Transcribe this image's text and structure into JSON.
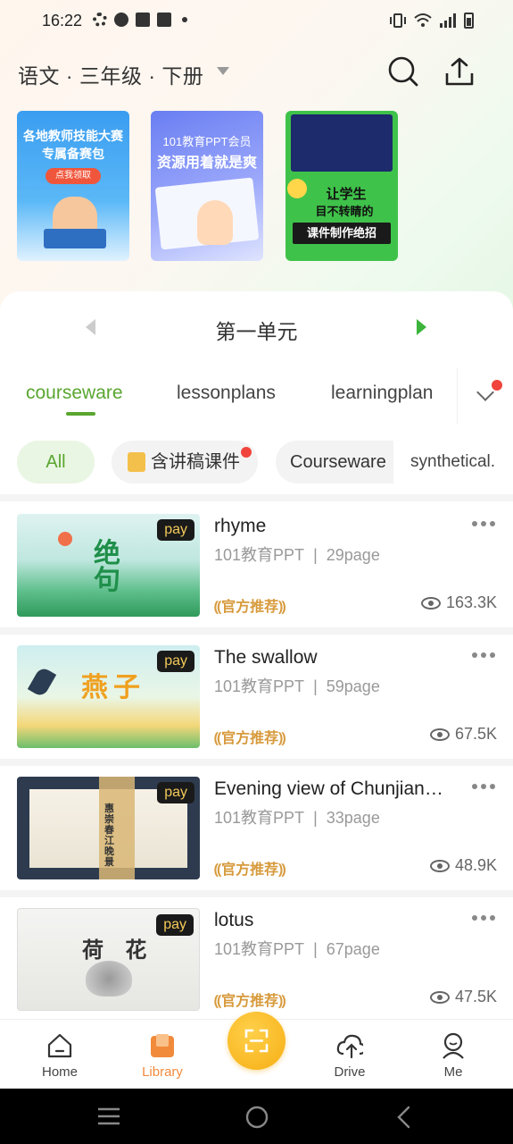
{
  "status": {
    "time": "16:22"
  },
  "header": {
    "subject": "语文 · 三年级 · 下册",
    "search_icon": "search-icon",
    "share_icon": "share-icon"
  },
  "banners": [
    {
      "line1": "各地教师技能大赛",
      "line2": "专属备赛包",
      "button": "点我领取"
    },
    {
      "line1": "101教育PPT会员",
      "line2": "资源用着就是爽"
    },
    {
      "line1": "让学生",
      "line2": "目不转睛的",
      "line3": "课件制作绝招"
    }
  ],
  "unit": {
    "title": "第一单元"
  },
  "tabs": [
    {
      "label": "courseware",
      "active": true
    },
    {
      "label": "lessonplans",
      "active": false
    },
    {
      "label": "learningplan",
      "active": false
    }
  ],
  "filters": [
    {
      "label": "All"
    },
    {
      "label": "含讲稿课件"
    },
    {
      "label": "Courseware"
    },
    {
      "label": "synthetical."
    }
  ],
  "items": [
    {
      "title": "rhyme",
      "publisher": "101教育PPT",
      "pages": "29page",
      "badge": "官方推荐",
      "views": "163.3K",
      "pay": "pay",
      "thumb_text": "绝句"
    },
    {
      "title": "The swallow",
      "publisher": "101教育PPT",
      "pages": "59page",
      "badge": "官方推荐",
      "views": "67.5K",
      "pay": "pay",
      "thumb_text": "燕子"
    },
    {
      "title": "Evening view of Chunjiang...",
      "publisher": "101教育PPT",
      "pages": "33page",
      "badge": "官方推荐",
      "views": "48.9K",
      "pay": "pay",
      "thumb_text": "惠崇春江晚景"
    },
    {
      "title": "lotus",
      "publisher": "101教育PPT",
      "pages": "67page",
      "badge": "官方推荐",
      "views": "47.5K",
      "pay": "pay",
      "thumb_text": "荷 花"
    }
  ],
  "meta_separator": "|",
  "nav": {
    "home": "Home",
    "library": "Library",
    "drive": "Drive",
    "me": "Me"
  },
  "colors": {
    "accent_green": "#5aa630",
    "library_orange": "#f28a3c",
    "scan_yellow": "#f6ae14",
    "badge_gold": "#d79a3c"
  }
}
